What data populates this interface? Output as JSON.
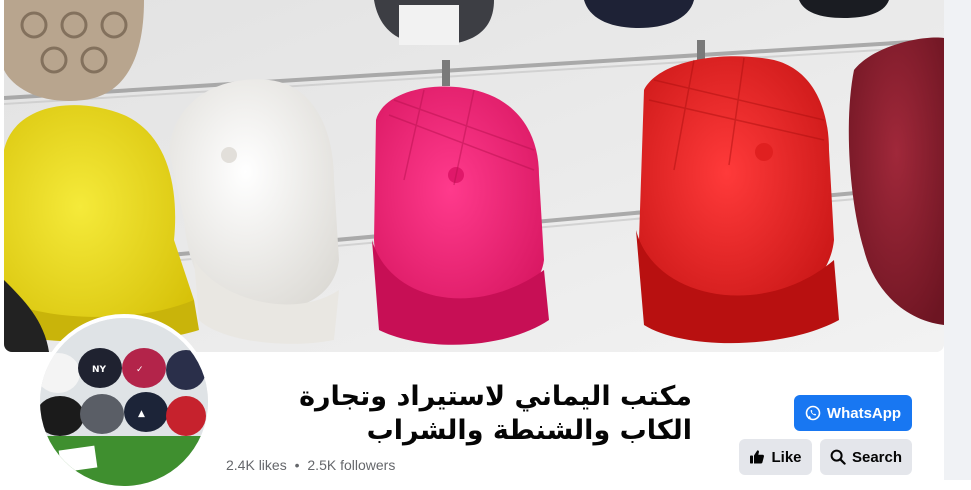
{
  "page": {
    "title": "مكتب اليماني لاستيراد وتجارة الكاب والشنطة والشراب",
    "likes": "2.4K likes",
    "separator": "•",
    "followers": "2.5K followers"
  },
  "actions": {
    "whatsapp_label": "WhatsApp",
    "like_label": "Like",
    "search_label": "Search"
  },
  "icons": {
    "whatsapp": "whatsapp-icon",
    "like": "thumbs-up-icon",
    "search": "search-icon"
  },
  "colors": {
    "primary": "#1877f2",
    "secondary_button": "#e4e6eb",
    "muted_text": "#65676b",
    "title_text": "#050505"
  }
}
